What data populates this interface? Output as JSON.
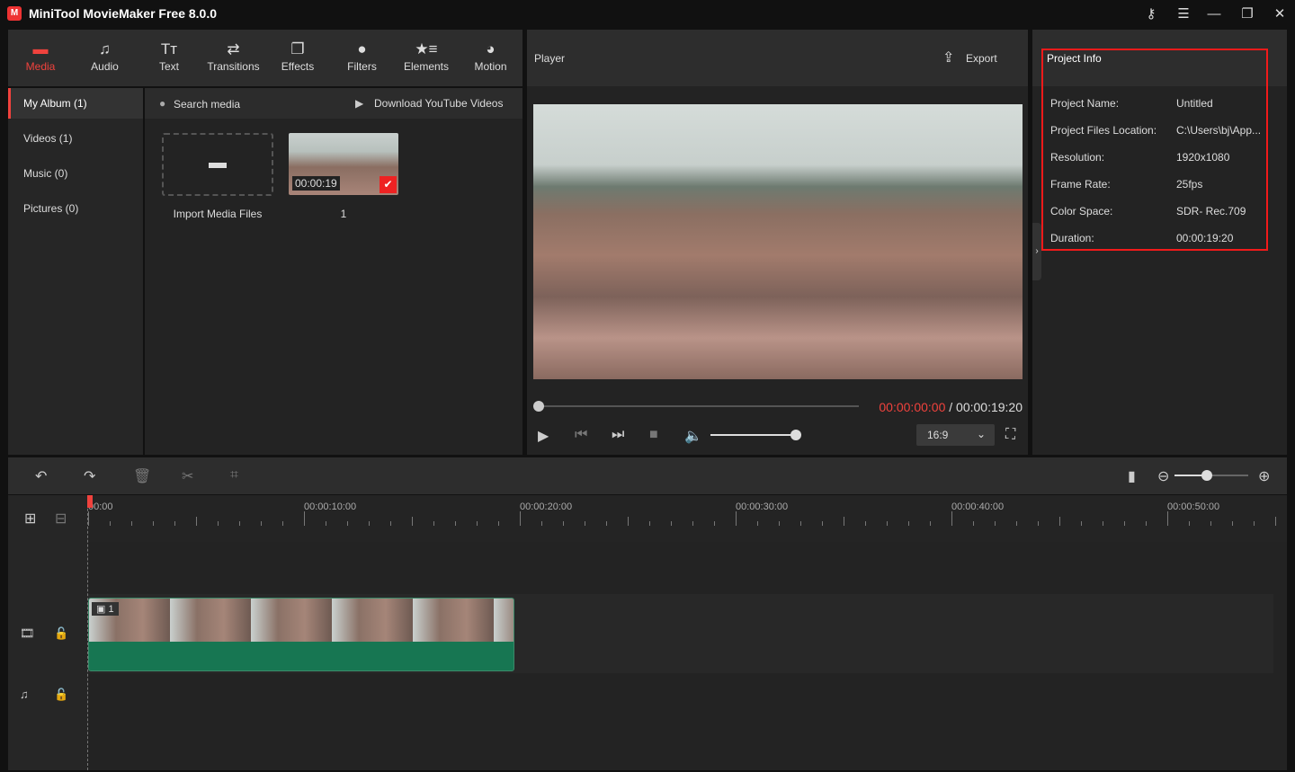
{
  "app": {
    "title": "MiniTool MovieMaker Free 8.0.0",
    "logo": "MT"
  },
  "window": {
    "key_icon": "key-icon",
    "menu": "☰",
    "minimize": "—",
    "maximize": "❐",
    "close": "✕"
  },
  "tools": [
    {
      "label": "Media",
      "icon": "▬",
      "active": true
    },
    {
      "label": "Audio",
      "icon": "♫"
    },
    {
      "label": "Text",
      "icon": "Tт"
    },
    {
      "label": "Transitions",
      "icon": "⇄"
    },
    {
      "label": "Effects",
      "icon": "❐"
    },
    {
      "label": "Filters",
      "icon": "●"
    },
    {
      "label": "Elements",
      "icon": "★≡"
    },
    {
      "label": "Motion",
      "icon": "◕"
    }
  ],
  "sidebar": [
    "My Album (1)",
    "Videos (1)",
    "Music (0)",
    "Pictures (0)"
  ],
  "media": {
    "search_placeholder": "Search media",
    "download": "Download YouTube Videos",
    "import_label": "Import Media Files",
    "clip_duration": "00:00:19",
    "clip_name": "1"
  },
  "player": {
    "title": "Player",
    "export": "Export",
    "current_time": "00:00:00:00",
    "separator": " / ",
    "total_time": "00:00:19:20",
    "aspect": "16:9",
    "progress": 0,
    "volume": 1.0
  },
  "project_info": {
    "title": "Project Info",
    "rows": [
      {
        "label": "Project Name:",
        "value": "Untitled"
      },
      {
        "label": "Project Files Location:",
        "value": "C:\\Users\\bj\\App..."
      },
      {
        "label": "Resolution:",
        "value": "1920x1080"
      },
      {
        "label": "Frame Rate:",
        "value": "25fps"
      },
      {
        "label": "Color Space:",
        "value": "SDR- Rec.709"
      },
      {
        "label": "Duration:",
        "value": "00:00:19:20"
      }
    ]
  },
  "timeline": {
    "ruler": [
      "00:00",
      "00:00:10:00",
      "00:00:20:00",
      "00:00:30:00",
      "00:00:40:00",
      "00:00:50:00"
    ],
    "clip_label": "1",
    "accent": "#f0423d",
    "clip_color": "#177652"
  }
}
